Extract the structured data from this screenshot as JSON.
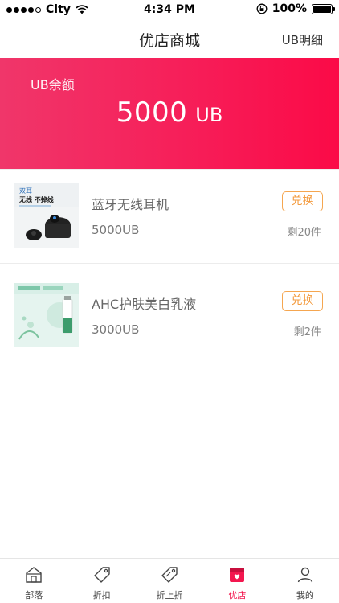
{
  "status_bar": {
    "carrier": "City",
    "time": "4:34 PM",
    "battery": "100%",
    "battery_level": 1.0
  },
  "nav": {
    "title": "优店商城",
    "right_link": "UB明细"
  },
  "balance": {
    "label": "UB余额",
    "amount": "5000",
    "unit": "UB"
  },
  "products": [
    {
      "name": "蓝牙无线耳机",
      "price": "5000UB",
      "exchange_label": "兑换",
      "stock": "剩20件",
      "thumb_text_1": "双耳",
      "thumb_text_2": "无线 不掉线"
    },
    {
      "name": "AHC护肤美白乳液",
      "price": "3000UB",
      "exchange_label": "兑换",
      "stock": "剩2件"
    }
  ],
  "tabs": [
    {
      "label": "部落",
      "icon": "house-icon",
      "active": false
    },
    {
      "label": "折扣",
      "icon": "tag-icon",
      "active": false
    },
    {
      "label": "折上折",
      "icon": "tag-discount-icon",
      "active": false
    },
    {
      "label": "优店",
      "icon": "shop-icon",
      "active": true
    },
    {
      "label": "我的",
      "icon": "person-icon",
      "active": false
    }
  ],
  "colors": {
    "accent": "#f3174f",
    "exchange_border": "#f5a650"
  }
}
